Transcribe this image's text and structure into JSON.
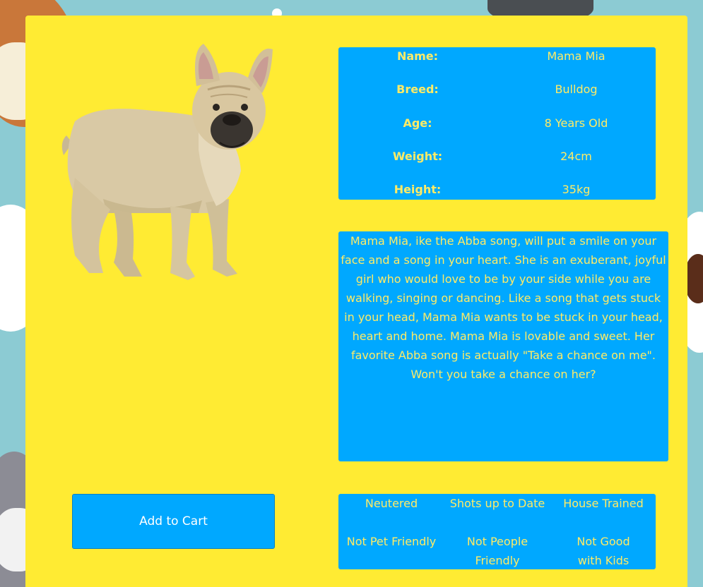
{
  "pet": {
    "info": [
      {
        "label": "Name:",
        "value": "Mama Mia"
      },
      {
        "label": "Breed:",
        "value": "Bulldog"
      },
      {
        "label": "Age:",
        "value": "8 Years Old"
      },
      {
        "label": "Weight:",
        "value": "24cm"
      },
      {
        "label": "Height:",
        "value": "35kg"
      }
    ],
    "description": "Mama Mia, ike the Abba song, will put a smile on your face and a song in your heart. She is an exuberant, joyful girl who would love to be by your side while you are walking, singing or dancing. Like a song that gets stuck in your head, Mama Mia wants to be stuck in your head, heart and home. Mama Mia is lovable and sweet. Her favorite Abba song is actually \"Take a chance on me\". Won't you take a chance on her?",
    "traits": [
      "Neutered",
      "Shots up to Date",
      "House Trained",
      "Not Pet Friendly",
      "Not People Friendly",
      "Not Good with Kids"
    ]
  },
  "actions": {
    "add_to_cart_label": "Add to Cart"
  },
  "colors": {
    "card_background": "#ffeb33",
    "panel_background": "#00a8ff",
    "panel_text": "#ffeb66",
    "page_background": "#8ccbd3"
  },
  "icons": {
    "dog_image": "french-bulldog-photo"
  }
}
